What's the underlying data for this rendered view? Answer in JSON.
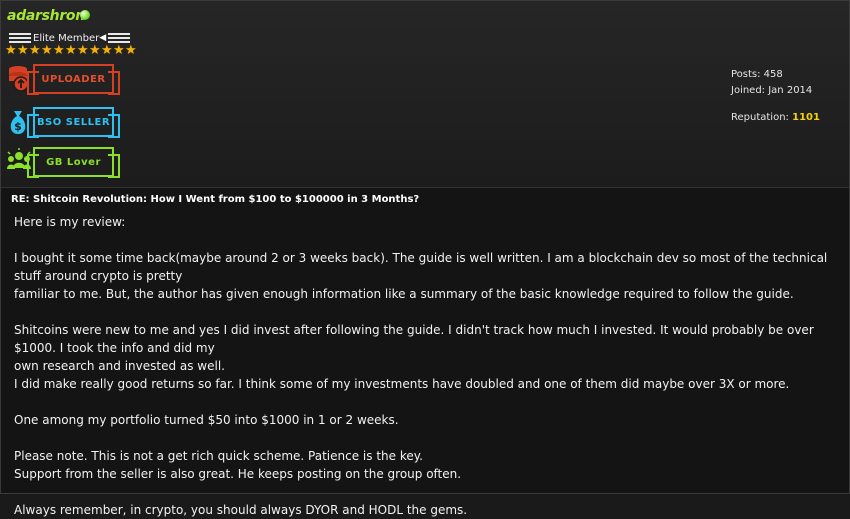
{
  "author": {
    "username": "adarshron",
    "rank": "Elite Member",
    "stars": 11,
    "badges": [
      {
        "label": "UPLOADER",
        "icon": "coin-stack-icon",
        "color": "#d64022"
      },
      {
        "label": "BSO SELLER",
        "icon": "money-bag-icon",
        "color": "#2fbff0"
      },
      {
        "label": "GB Lover",
        "icon": "community-icon",
        "color": "#8be02a"
      }
    ],
    "posts": "Posts: 458",
    "joined": "Joined: Jan 2014",
    "reputation_label": "Reputation:",
    "reputation_value": "1101"
  },
  "post": {
    "subject": "RE: Shitcoin Revolution: How I Went from $100 to $100000 in 3 Months?",
    "lines": [
      "Here is my review:",
      "",
      "I bought it some time back(maybe around 2 or 3 weeks back). The guide is well written. I am a blockchain dev so most of the technical stuff around crypto is pretty",
      "familiar to me. But, the author has given enough information like a summary of the basic knowledge required to follow the guide.",
      "",
      "Shitcoins were new to me and yes I did invest after following the guide. I didn't track how much I invested. It would probably be over $1000. I took the info and did my",
      "own research and invested as well.",
      "I did make really good returns so far. I think some of my investments have doubled and one of them did maybe over 3X or more.",
      "",
      "One among my portfolio turned $50 into $1000 in 1 or 2 weeks.",
      "",
      "Please note. This is not a get rich quick scheme. Patience is the key.",
      "Support from the seller is also great. He keeps posting on the group often.",
      "",
      "Always remember, in crypto, you should always DYOR and HODL the gems."
    ]
  }
}
